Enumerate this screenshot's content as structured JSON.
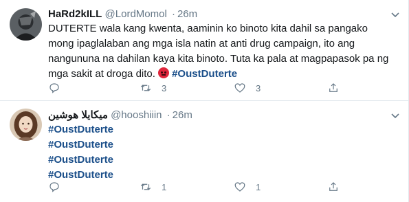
{
  "tweets": [
    {
      "display_name": "HaRd2kILL",
      "handle": "@LordMomol",
      "time": "26m",
      "text": "DUTERTE wala kang kwenta, aaminin ko binoto kita dahil sa pangako mong ipaglalaban ang mga isla natin at anti drug campaign, ito ang nangununa na dahilan kaya kita binoto. Tuta ka pala at magpapasok pa ng mga sakit at droga dito.",
      "hashtag": "#OustDuterte",
      "retweets": "3",
      "likes": "3"
    },
    {
      "display_name": "ميكايلا هوشين",
      "handle": "@hooshiiin",
      "time": "26m",
      "hashtags": [
        "#OustDuterte",
        "#OustDuterte",
        "#OustDuterte",
        "#OustDuterte"
      ],
      "retweets": "1",
      "likes": "1"
    }
  ],
  "separator": "·",
  "icons": {
    "reply": "reply-icon",
    "retweet": "retweet-icon",
    "like": "heart-icon",
    "share": "share-icon",
    "menu": "chevron-down-icon",
    "emoji": "angry-face-emoji"
  },
  "colors": {
    "hashtag": "#1b4f8a",
    "secondary_text": "#657786",
    "divider": "#e1e8ed"
  }
}
